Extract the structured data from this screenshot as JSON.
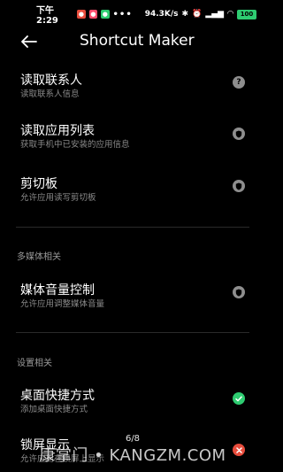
{
  "status_bar": {
    "time": "下午2:29",
    "dots": "•••",
    "network_speed": "94.3K/s",
    "battery": "100"
  },
  "app_bar": {
    "title": "Shortcut Maker",
    "back_icon": "arrow-left-icon"
  },
  "permissions": [
    {
      "title": "读取联系人",
      "subtitle": "读取联系人信息",
      "status": "unknown",
      "icon": "help-circle-icon"
    },
    {
      "title": "读取应用列表",
      "subtitle": "获取手机中已安装的应用信息",
      "status": "shield",
      "icon": "shield-icon"
    },
    {
      "title": "剪切板",
      "subtitle": "允许应用读写剪切板",
      "status": "shield",
      "icon": "shield-icon"
    }
  ],
  "sections": [
    {
      "header": "多媒体相关",
      "items": [
        {
          "title": "媒体音量控制",
          "subtitle": "允许应用调整媒体音量",
          "status": "shield",
          "icon": "shield-icon"
        }
      ]
    },
    {
      "header": "设置相关",
      "items": [
        {
          "title": "桌面快捷方式",
          "subtitle": "添加桌面快捷方式",
          "status": "granted",
          "icon": "check-circle-icon"
        },
        {
          "title": "锁屏显示",
          "subtitle": "允许应用在锁屏上显示",
          "status": "denied",
          "icon": "close-circle-icon"
        }
      ]
    }
  ],
  "page_indicator": "6/8",
  "watermark": "康掌门 • KANGZM.COM",
  "colors": {
    "background": "#000000",
    "granted": "#2ecc71",
    "denied": "#e74c3c",
    "neutral": "#8e8e8e"
  }
}
